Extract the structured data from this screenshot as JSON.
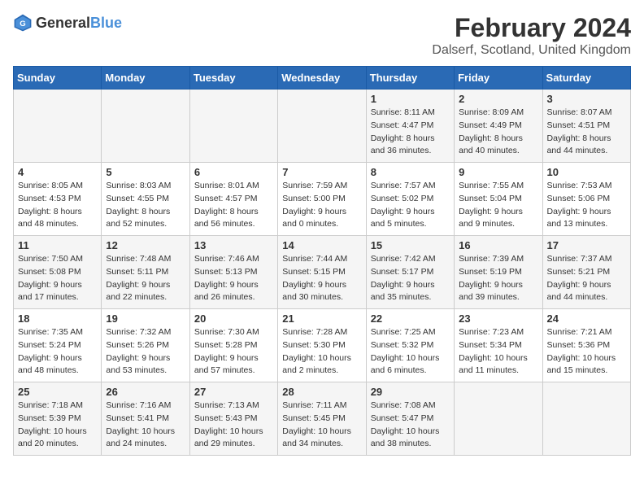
{
  "header": {
    "logo_general": "General",
    "logo_blue": "Blue",
    "main_title": "February 2024",
    "subtitle": "Dalserf, Scotland, United Kingdom"
  },
  "weekdays": [
    "Sunday",
    "Monday",
    "Tuesday",
    "Wednesday",
    "Thursday",
    "Friday",
    "Saturday"
  ],
  "weeks": [
    [
      {
        "day": "",
        "info": ""
      },
      {
        "day": "",
        "info": ""
      },
      {
        "day": "",
        "info": ""
      },
      {
        "day": "",
        "info": ""
      },
      {
        "day": "1",
        "info": "Sunrise: 8:11 AM\nSunset: 4:47 PM\nDaylight: 8 hours\nand 36 minutes."
      },
      {
        "day": "2",
        "info": "Sunrise: 8:09 AM\nSunset: 4:49 PM\nDaylight: 8 hours\nand 40 minutes."
      },
      {
        "day": "3",
        "info": "Sunrise: 8:07 AM\nSunset: 4:51 PM\nDaylight: 8 hours\nand 44 minutes."
      }
    ],
    [
      {
        "day": "4",
        "info": "Sunrise: 8:05 AM\nSunset: 4:53 PM\nDaylight: 8 hours\nand 48 minutes."
      },
      {
        "day": "5",
        "info": "Sunrise: 8:03 AM\nSunset: 4:55 PM\nDaylight: 8 hours\nand 52 minutes."
      },
      {
        "day": "6",
        "info": "Sunrise: 8:01 AM\nSunset: 4:57 PM\nDaylight: 8 hours\nand 56 minutes."
      },
      {
        "day": "7",
        "info": "Sunrise: 7:59 AM\nSunset: 5:00 PM\nDaylight: 9 hours\nand 0 minutes."
      },
      {
        "day": "8",
        "info": "Sunrise: 7:57 AM\nSunset: 5:02 PM\nDaylight: 9 hours\nand 5 minutes."
      },
      {
        "day": "9",
        "info": "Sunrise: 7:55 AM\nSunset: 5:04 PM\nDaylight: 9 hours\nand 9 minutes."
      },
      {
        "day": "10",
        "info": "Sunrise: 7:53 AM\nSunset: 5:06 PM\nDaylight: 9 hours\nand 13 minutes."
      }
    ],
    [
      {
        "day": "11",
        "info": "Sunrise: 7:50 AM\nSunset: 5:08 PM\nDaylight: 9 hours\nand 17 minutes."
      },
      {
        "day": "12",
        "info": "Sunrise: 7:48 AM\nSunset: 5:11 PM\nDaylight: 9 hours\nand 22 minutes."
      },
      {
        "day": "13",
        "info": "Sunrise: 7:46 AM\nSunset: 5:13 PM\nDaylight: 9 hours\nand 26 minutes."
      },
      {
        "day": "14",
        "info": "Sunrise: 7:44 AM\nSunset: 5:15 PM\nDaylight: 9 hours\nand 30 minutes."
      },
      {
        "day": "15",
        "info": "Sunrise: 7:42 AM\nSunset: 5:17 PM\nDaylight: 9 hours\nand 35 minutes."
      },
      {
        "day": "16",
        "info": "Sunrise: 7:39 AM\nSunset: 5:19 PM\nDaylight: 9 hours\nand 39 minutes."
      },
      {
        "day": "17",
        "info": "Sunrise: 7:37 AM\nSunset: 5:21 PM\nDaylight: 9 hours\nand 44 minutes."
      }
    ],
    [
      {
        "day": "18",
        "info": "Sunrise: 7:35 AM\nSunset: 5:24 PM\nDaylight: 9 hours\nand 48 minutes."
      },
      {
        "day": "19",
        "info": "Sunrise: 7:32 AM\nSunset: 5:26 PM\nDaylight: 9 hours\nand 53 minutes."
      },
      {
        "day": "20",
        "info": "Sunrise: 7:30 AM\nSunset: 5:28 PM\nDaylight: 9 hours\nand 57 minutes."
      },
      {
        "day": "21",
        "info": "Sunrise: 7:28 AM\nSunset: 5:30 PM\nDaylight: 10 hours\nand 2 minutes."
      },
      {
        "day": "22",
        "info": "Sunrise: 7:25 AM\nSunset: 5:32 PM\nDaylight: 10 hours\nand 6 minutes."
      },
      {
        "day": "23",
        "info": "Sunrise: 7:23 AM\nSunset: 5:34 PM\nDaylight: 10 hours\nand 11 minutes."
      },
      {
        "day": "24",
        "info": "Sunrise: 7:21 AM\nSunset: 5:36 PM\nDaylight: 10 hours\nand 15 minutes."
      }
    ],
    [
      {
        "day": "25",
        "info": "Sunrise: 7:18 AM\nSunset: 5:39 PM\nDaylight: 10 hours\nand 20 minutes."
      },
      {
        "day": "26",
        "info": "Sunrise: 7:16 AM\nSunset: 5:41 PM\nDaylight: 10 hours\nand 24 minutes."
      },
      {
        "day": "27",
        "info": "Sunrise: 7:13 AM\nSunset: 5:43 PM\nDaylight: 10 hours\nand 29 minutes."
      },
      {
        "day": "28",
        "info": "Sunrise: 7:11 AM\nSunset: 5:45 PM\nDaylight: 10 hours\nand 34 minutes."
      },
      {
        "day": "29",
        "info": "Sunrise: 7:08 AM\nSunset: 5:47 PM\nDaylight: 10 hours\nand 38 minutes."
      },
      {
        "day": "",
        "info": ""
      },
      {
        "day": "",
        "info": ""
      }
    ]
  ]
}
